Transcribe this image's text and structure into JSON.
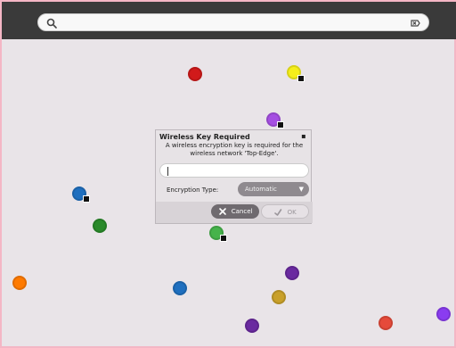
{
  "topbar": {
    "search": {
      "placeholder": ""
    }
  },
  "networks": [
    {
      "color": "#d11a1a",
      "secured": false
    },
    {
      "color": "#f5ee1b",
      "secured": true
    },
    {
      "color": "#a54fe2",
      "secured": true
    },
    {
      "color": "#1f6fbf",
      "secured": true
    },
    {
      "color": "#2a8a2a",
      "secured": false
    },
    {
      "color": "#46b34b",
      "secured": true
    },
    {
      "color": "#ff7a00",
      "secured": false
    },
    {
      "color": "#1f6fbf",
      "secured": false
    },
    {
      "color": "#6a2aa0",
      "secured": false
    },
    {
      "color": "#c9a02a",
      "secured": false
    },
    {
      "color": "#6a2aa0",
      "secured": false
    },
    {
      "color": "#e64a3a",
      "secured": false
    },
    {
      "color": "#8a3cf0",
      "secured": false
    }
  ],
  "dialog": {
    "title": "Wireless Key Required",
    "message": "A wireless encryption key is required for the wireless network 'Top-Edge'.",
    "key_value": "",
    "encryption": {
      "label": "Encryption Type:",
      "selected": "Automatic"
    },
    "buttons": {
      "cancel": "Cancel",
      "ok": "OK"
    }
  }
}
